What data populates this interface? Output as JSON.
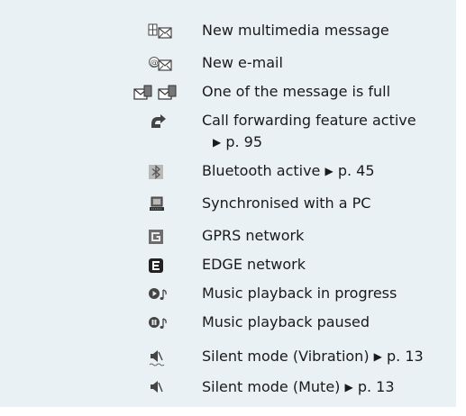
{
  "colors": {
    "background": "#e9f1f4",
    "text": "#1a1a1a",
    "icon_dark": "#333333",
    "icon_mid": "#6d6d6d",
    "icon_light": "#b9b9b9"
  },
  "items": [
    {
      "icon": "multimedia-message-icon",
      "text": "New multimedia message"
    },
    {
      "icon": "email-icon",
      "text": "New e-mail"
    },
    {
      "icon": "message-full-icon",
      "text": "One of the message is full"
    },
    {
      "icon": "call-forwarding-icon",
      "text": "Call forwarding feature active",
      "ref": "p. 95"
    },
    {
      "icon": "bluetooth-icon",
      "text": "Bluetooth active",
      "ref": "p. 45"
    },
    {
      "icon": "pc-sync-icon",
      "text": "Synchronised with a PC"
    },
    {
      "icon": "gprs-icon",
      "text": "GPRS network"
    },
    {
      "icon": "edge-icon",
      "text": "EDGE network"
    },
    {
      "icon": "music-playing-icon",
      "text": "Music playback in progress"
    },
    {
      "icon": "music-paused-icon",
      "text": "Music playback paused"
    },
    {
      "icon": "silent-vibration-icon",
      "text": "Silent mode (Vibration)",
      "ref": "p. 13"
    },
    {
      "icon": "silent-mute-icon",
      "text": "Silent mode (Mute)",
      "ref": "p. 13"
    }
  ]
}
